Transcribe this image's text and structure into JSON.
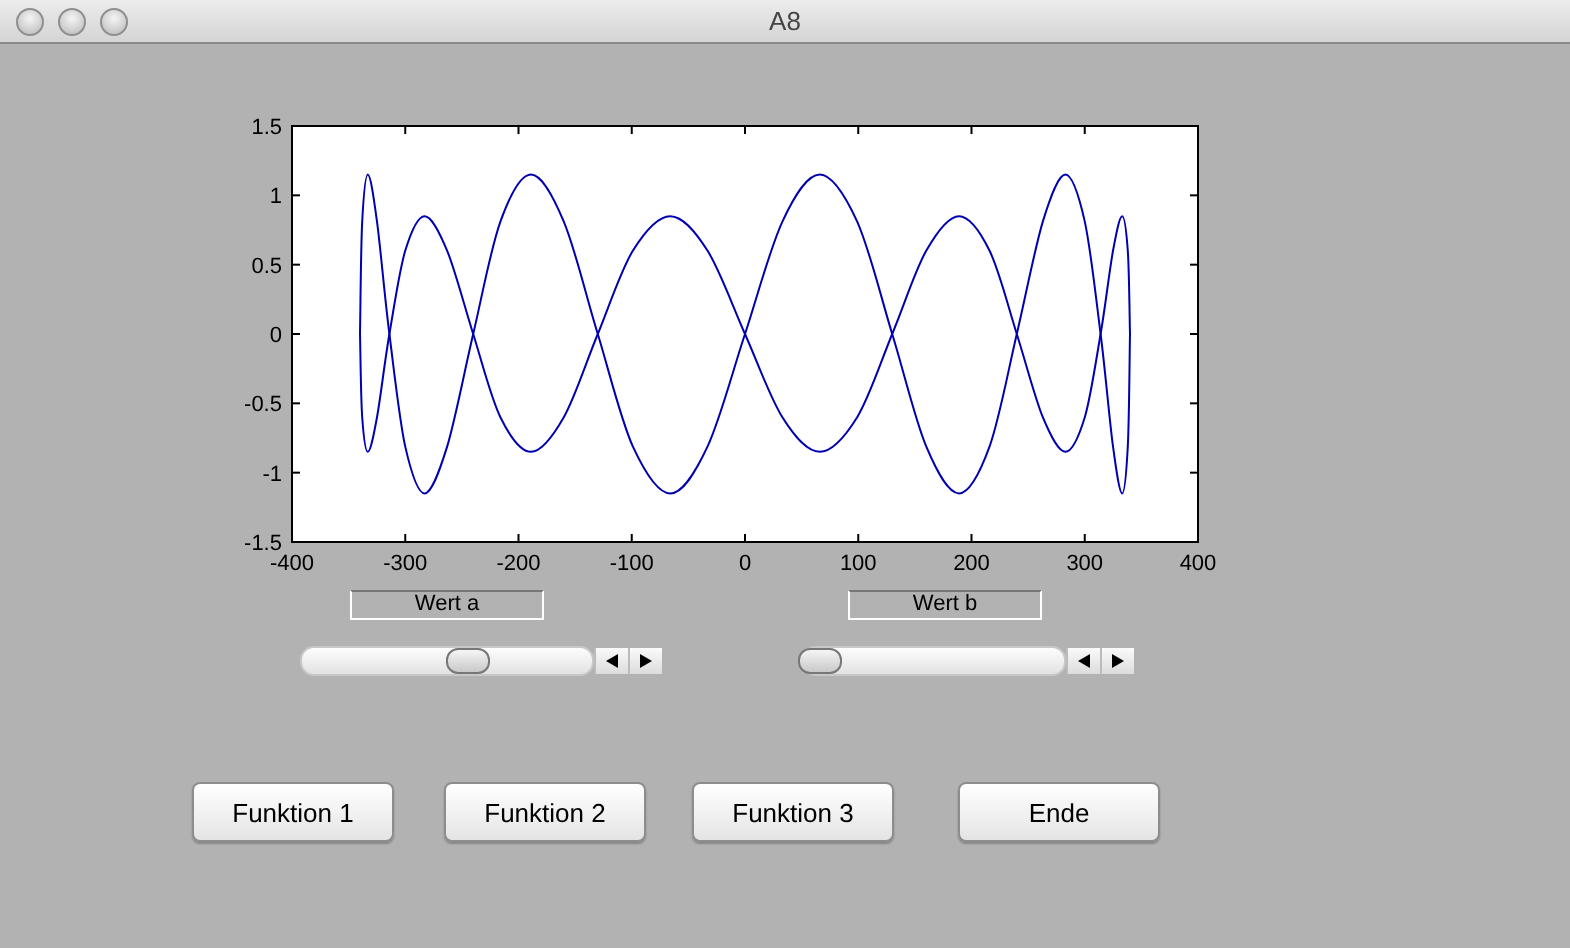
{
  "window": {
    "title": "A8"
  },
  "plot": {
    "chart_data": {
      "type": "line",
      "xlim": [
        -400,
        400
      ],
      "ylim": [
        -1.5,
        1.5
      ],
      "xticks": [
        -400,
        -300,
        -200,
        -100,
        0,
        100,
        200,
        300,
        400
      ],
      "yticks": [
        -1.5,
        -1,
        -0.5,
        0,
        0.5,
        1,
        1.5
      ],
      "x": [
        -340,
        -338,
        -333,
        -325,
        -314,
        -300,
        -283,
        -263,
        -240,
        -216,
        -189,
        -160,
        -130,
        -99,
        -66,
        -33,
        0,
        33,
        66,
        99,
        130,
        160,
        189,
        216,
        240,
        263,
        283,
        300,
        314,
        325,
        333,
        338,
        340
      ],
      "series": [
        {
          "values": [
            0,
            0.81,
            1.15,
            0.81,
            0,
            -0.81,
            -1.15,
            -0.81,
            0,
            0.81,
            1.15,
            0.81,
            0,
            -0.81,
            -1.15,
            -0.81,
            0,
            0.81,
            1.15,
            0.81,
            0,
            -0.81,
            -1.15,
            -0.81,
            0,
            0.81,
            1.15,
            0.81,
            0,
            -0.81,
            -1.15,
            -0.81,
            0
          ]
        },
        {
          "values": [
            0,
            -0.6,
            -0.85,
            -0.6,
            0,
            0.6,
            0.85,
            0.6,
            0,
            -0.6,
            -0.85,
            -0.6,
            0,
            0.6,
            0.85,
            0.6,
            0,
            -0.6,
            -0.85,
            -0.6,
            0,
            0.6,
            0.85,
            0.6,
            0,
            -0.6,
            -0.85,
            -0.6,
            0,
            0.6,
            0.85,
            0.6,
            0
          ]
        }
      ]
    }
  },
  "labels": [
    "Wert a",
    "Wert b"
  ],
  "sliders": [
    {
      "level": 0.55
    },
    {
      "level": 0.04
    }
  ],
  "buttons": [
    "Funktion 1",
    "Funktion 2",
    "Funktion 3",
    "Ende"
  ]
}
